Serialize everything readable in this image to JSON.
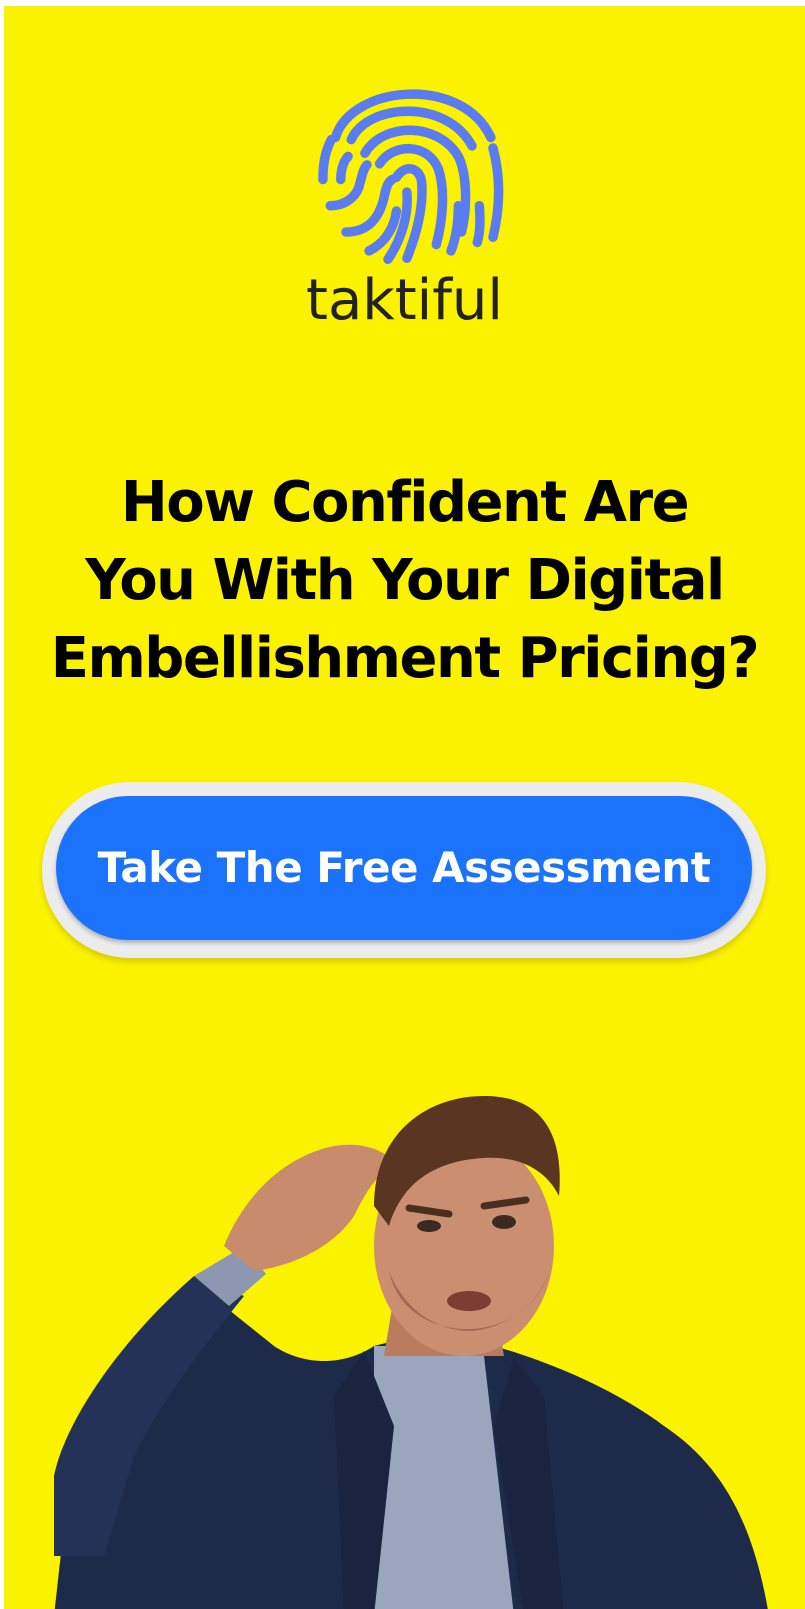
{
  "brand": {
    "name": "taktiful",
    "logo_icon": "fingerprint-icon",
    "logo_color": "#5B7CF0"
  },
  "headline": {
    "line1": "How Confident Are",
    "line2": "You With Your Digital",
    "line3": "Embellishment Pricing?"
  },
  "cta": {
    "label": "Take The Free Assessment",
    "color": "#1A73FA"
  },
  "colors": {
    "background": "#FBF200",
    "text": "#000000"
  }
}
